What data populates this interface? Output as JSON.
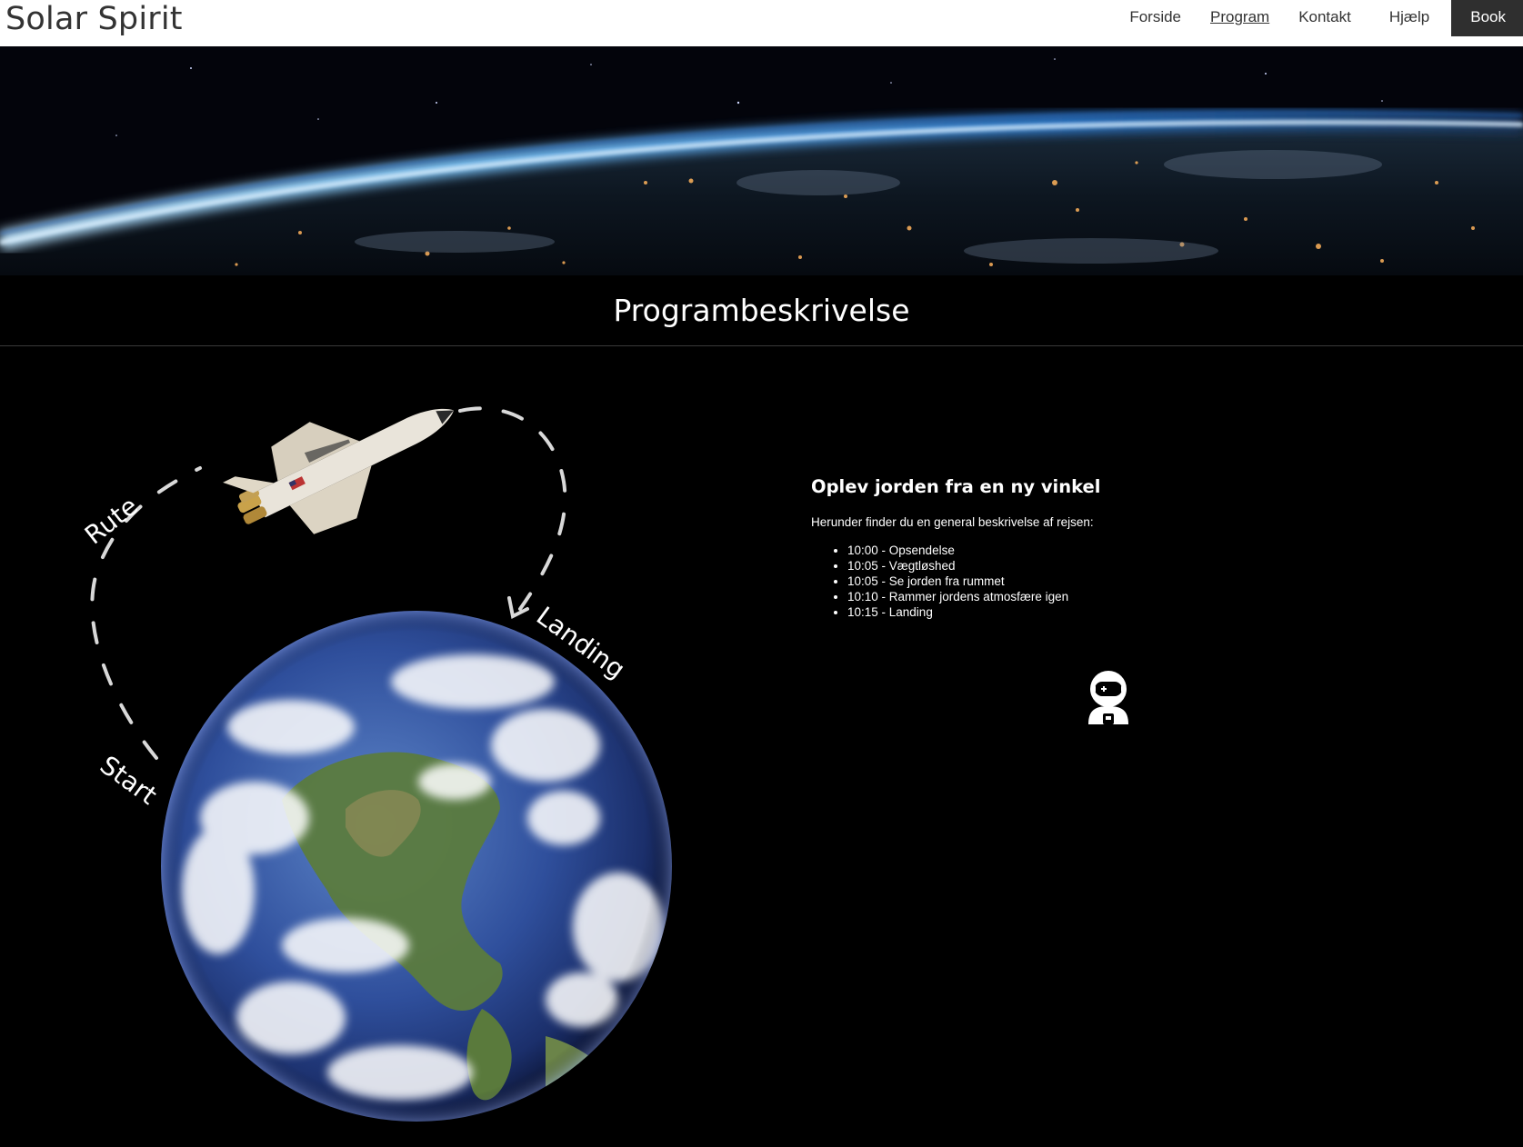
{
  "header": {
    "brand": "Solar Spirit",
    "nav": [
      {
        "label": "Forside",
        "active": false
      },
      {
        "label": "Program",
        "active": true
      },
      {
        "label": "Kontakt",
        "active": false
      },
      {
        "label": "Hjælp",
        "active": false
      },
      {
        "label": "Book",
        "active": false
      }
    ]
  },
  "hero": {
    "image": "earth-horizon-from-orbit-photo"
  },
  "section": {
    "title": "Programbeskrivelse"
  },
  "illustration": {
    "labels": {
      "start": "Start",
      "route": "Rute",
      "landing": "Landing"
    },
    "images": [
      "space-shuttle",
      "earth-globe",
      "dashed-route-arrow"
    ]
  },
  "content": {
    "heading": "Oplev jorden fra en ny vinkel",
    "intro": "Herunder finder du en general beskrivelse af rejsen:",
    "schedule": [
      "10:00 - Opsendelse",
      "10:05 - Vægtløshed",
      "10:05 - Se jorden fra rummet",
      "10:10 - Rammer jordens atmosfære igen",
      "10:15 - Landing"
    ]
  },
  "icons": {
    "astronaut": "astronaut-icon"
  },
  "colors": {
    "header_bg": "#ffffff",
    "page_bg": "#000000",
    "book_button_bg": "#2f2f2f",
    "text_light": "#ffffff",
    "text_dark": "#333333"
  }
}
